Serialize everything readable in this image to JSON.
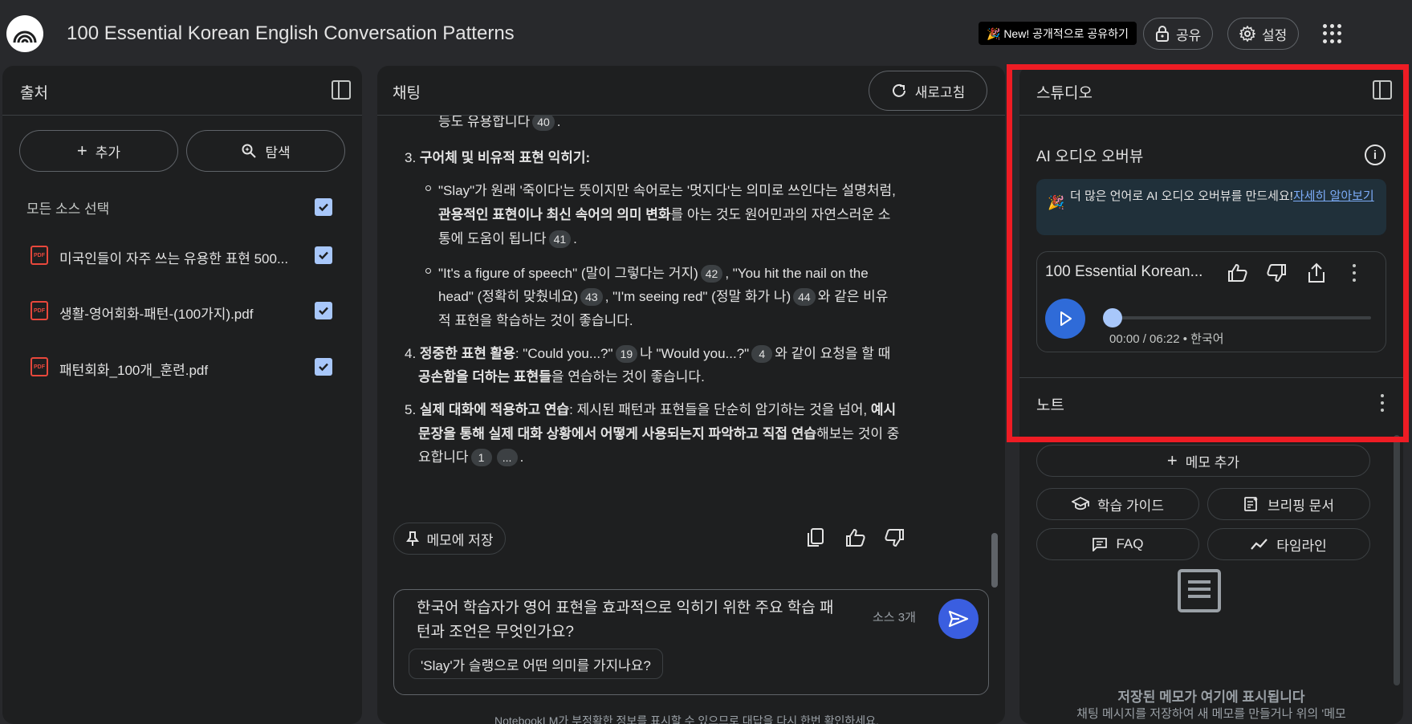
{
  "app": {
    "title": "100 Essential Korean English Conversation Patterns"
  },
  "header": {
    "new_badge": "🎉 New! 공개적으로 공유하기",
    "share_label": "공유",
    "settings_label": "설정"
  },
  "sources": {
    "title": "출처",
    "add_label": "추가",
    "explore_label": "탐색",
    "select_all_label": "모든 소스 선택",
    "items": [
      {
        "name": "미국인들이 자주 쓰는 유용한 표현 500...",
        "icon": "pdf-icon",
        "checked": true
      },
      {
        "name": "생활-영어회화-패턴-(100가지).pdf",
        "icon": "pdf-icon",
        "checked": true
      },
      {
        "name": "패턴회화_100개_훈련.pdf",
        "icon": "pdf-icon",
        "checked": true
      }
    ]
  },
  "chat": {
    "title": "채팅",
    "refresh_label": "새로고침",
    "partial_top": "등도 유용합니다",
    "partial_top_cite": "40",
    "item3": {
      "num": "3.",
      "heading": "구어체 및 비유적 표현 익히기",
      "colon": ":",
      "sub1_line1": "\"Slay\"가 원래 '죽이다'는 뜻이지만 속어로는 '멋지다'는 의미로 쓰인다는 설명처럼,",
      "sub1_line2_bold": "관용적인 표현이나 최신 속어의 의미 변화",
      "sub1_line2_rest": "를 아는 것도 원어민과의 자연스러운 소",
      "sub1_line3": "통에 도움이 됩니다",
      "sub1_cite": "41",
      "sub2_line1_a": "\"It's a figure of speech\" (말이 그렇다는 거지)",
      "sub2_cite1": "42",
      "sub2_line1_b": ", \"You hit the nail on the",
      "sub2_line2_a": "head\" (정확히 맞췄네요)",
      "sub2_cite2": "43",
      "sub2_line2_b": ", \"I'm seeing red\" (정말 화가 나)",
      "sub2_cite3": "44",
      "sub2_line2_c": "와 같은 비유",
      "sub2_line3": "적 표현을 학습하는 것이 좋습니다."
    },
    "item4": {
      "num": "4.",
      "heading": "정중한 표현 활용",
      "line1_a": ": \"Could you...?\"",
      "cite1": "19",
      "line1_b": "나 \"Would you...?\"",
      "cite2": "4",
      "line1_c": "와 같이 요청을 할 때",
      "line2_bold": "공손함을 더하는 표현들",
      "line2_rest": "을 연습하는 것이 좋습니다."
    },
    "item5": {
      "num": "5.",
      "heading": "실제 대화에 적용하고 연습",
      "line1_rest": ": 제시된 패턴과 표현들을 단순히 암기하는 것을 넘어,",
      "line1_bold": "예시",
      "line2_bold": "문장을 통해 실제 대화 상황에서 어떻게 사용되는지 파악하고 직접 연습",
      "line2_rest": "해보는 것이 중",
      "line3": "요합니다",
      "cite1": "1",
      "cite2": "..."
    },
    "save_note_label": "메모에 저장",
    "input_text": "한국어 학습자가 영어 표현을 효과적으로 익히기 위한 주요 학습 패턴과 조언은 무엇인가요?",
    "source_count": "소스 3개",
    "suggestion": "'Slay'가 슬랭으로 어떤 의미를 가지나요?",
    "disclaimer": "NotebookLM가 부정확한 정보를 표시할 수 있으므로 대답을 다시 한번 확인하세요."
  },
  "studio": {
    "title": "스튜디오",
    "audio_section_title": "AI 오디오 오버뷰",
    "promo_text": "더 많은 언어로 AI 오디오 오버뷰를 만드세요!",
    "promo_link": "자세히 알아보기",
    "audio": {
      "title": "100 Essential Korean...",
      "time": "00:00 / 06:22 • 한국어",
      "progress": 0
    },
    "notes_title": "노트",
    "add_note_label": "메모 추가",
    "buttons": {
      "study_guide": "학습 가이드",
      "briefing": "브리핑 문서",
      "faq": "FAQ",
      "timeline": "타임라인"
    },
    "empty_title": "저장된 메모가 여기에 표시됩니다",
    "empty_desc": "채팅 메시지를 저장하여 새 메모를 만들거나 위의 '메모"
  },
  "colors": {
    "accent_blue": "#3a5ee0",
    "checkbox": "#a8c7fa",
    "pdf_red": "#e8483c",
    "highlight_red": "#ee1c24"
  }
}
